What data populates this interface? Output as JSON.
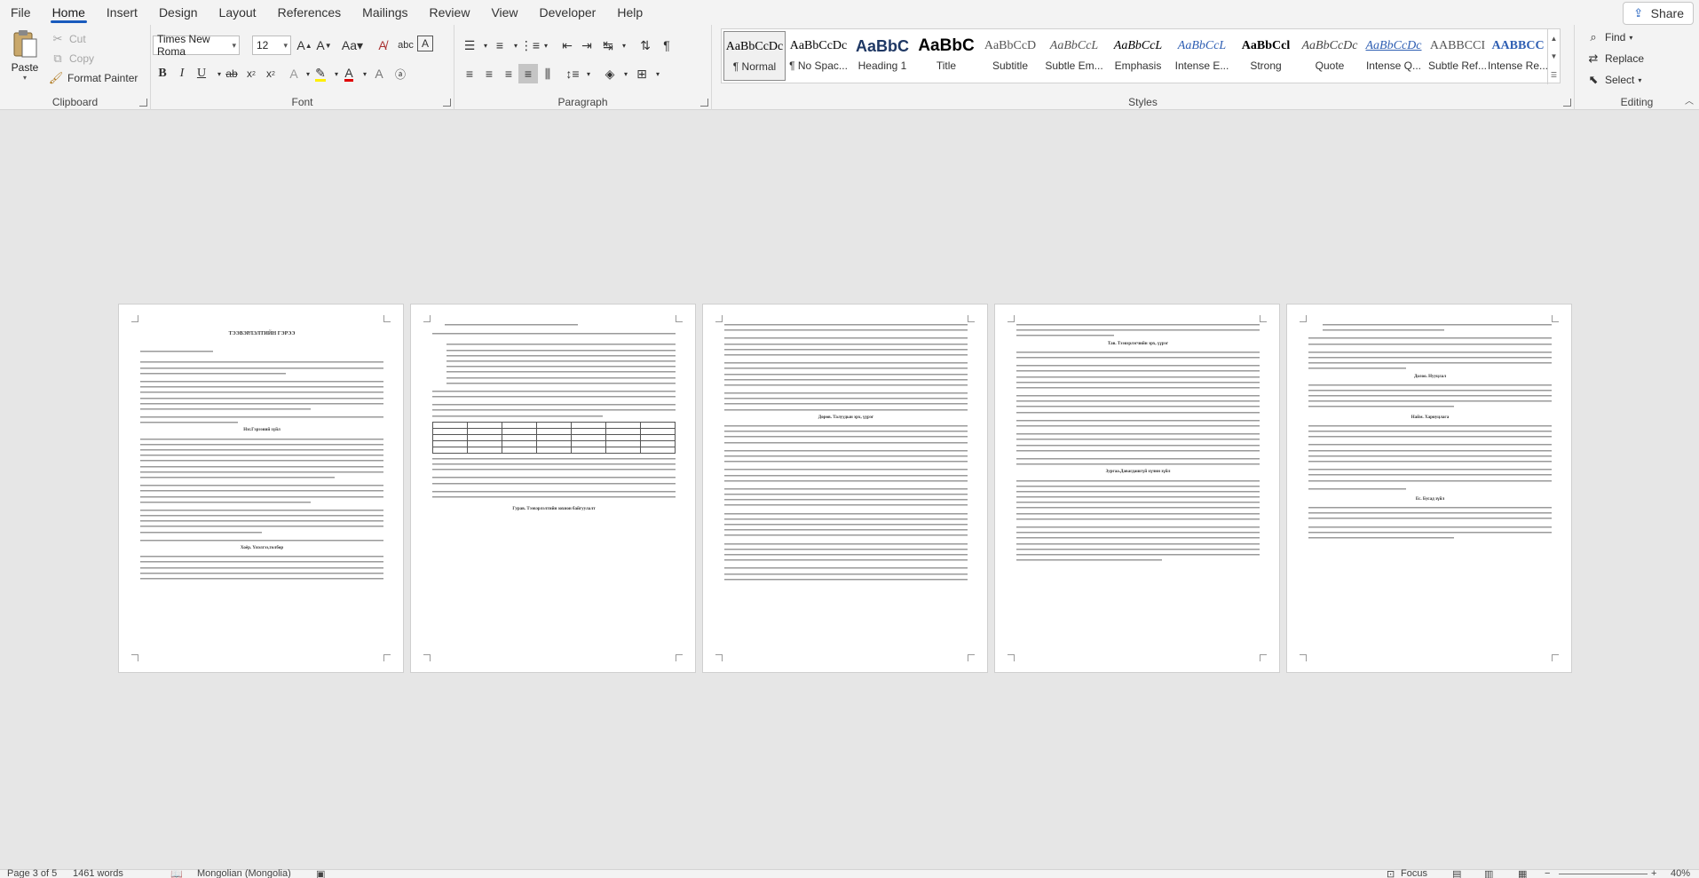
{
  "menu": {
    "tabs": [
      "File",
      "Home",
      "Insert",
      "Design",
      "Layout",
      "References",
      "Mailings",
      "Review",
      "View",
      "Developer",
      "Help"
    ],
    "active": "Home",
    "share_label": "Share"
  },
  "clipboard": {
    "paste": "Paste",
    "cut": "Cut",
    "copy": "Copy",
    "format_painter": "Format Painter",
    "label": "Clipboard"
  },
  "font": {
    "family": "Times New Roma",
    "size": "12",
    "label": "Font"
  },
  "paragraph": {
    "label": "Paragraph"
  },
  "styles": {
    "label": "Styles",
    "items": [
      {
        "preview": "AaBbCcDc",
        "name": "¶ Normal"
      },
      {
        "preview": "AaBbCcDc",
        "name": "¶ No Spac..."
      },
      {
        "preview": "AaBbC",
        "name": "Heading 1"
      },
      {
        "preview": "AaBbC",
        "name": "Title"
      },
      {
        "preview": "AaBbCcD",
        "name": "Subtitle"
      },
      {
        "preview": "AaBbCcL",
        "name": "Subtle Em..."
      },
      {
        "preview": "AaBbCcL",
        "name": "Emphasis"
      },
      {
        "preview": "AaBbCcL",
        "name": "Intense E..."
      },
      {
        "preview": "AaBbCcl",
        "name": "Strong"
      },
      {
        "preview": "AaBbCcDc",
        "name": "Quote"
      },
      {
        "preview": "AaBbCcDc",
        "name": "Intense Q..."
      },
      {
        "preview": "AABBCCI",
        "name": "Subtle Ref..."
      },
      {
        "preview": "AABBCC",
        "name": "Intense Re..."
      }
    ]
  },
  "editing": {
    "find": "Find",
    "replace": "Replace",
    "select": "Select",
    "label": "Editing"
  },
  "pages": [
    {
      "title": "ТЭЭВЭРЛЭЛТИЙН ГЭРЭЭ",
      "headings": [
        "Нэг.Гэрээний зүйл",
        "Хоёр. Үнэлгээ,төлбөр"
      ]
    },
    {
      "headings": [
        "Гурав. Тээвэрлэлтийн зохион байгуулалт"
      ]
    },
    {
      "headings": [
        "Дөрөв. Талуудын эрх, үүрэг"
      ]
    },
    {
      "headings": [
        "Тав. Тээвэрлэгчийн эрх, үүрэг",
        "Зургаа.Давагдашгүй хүчин зүйл"
      ]
    },
    {
      "headings": [
        "Долоо. Нууцлал",
        "Найм. Хариуцлага",
        "Ес. Бусад зүйл"
      ]
    }
  ],
  "status": {
    "page": "Page 3 of 5",
    "words": "1461 words",
    "language": "Mongolian (Mongolia)",
    "focus": "Focus",
    "zoom": "40%"
  }
}
